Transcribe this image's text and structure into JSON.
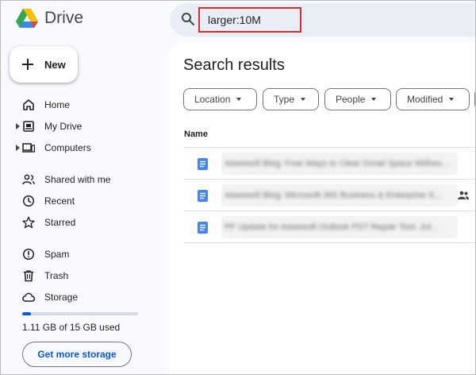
{
  "app": {
    "name": "Drive"
  },
  "search": {
    "query": "larger:10M"
  },
  "sidebar": {
    "new_label": "New",
    "items": [
      {
        "label": "Home",
        "icon": "home-icon"
      },
      {
        "label": "My Drive",
        "icon": "drive-icon"
      },
      {
        "label": "Computers",
        "icon": "computer-icon"
      },
      {
        "label": "Shared with me",
        "icon": "people-icon"
      },
      {
        "label": "Recent",
        "icon": "clock-icon"
      },
      {
        "label": "Starred",
        "icon": "star-icon"
      },
      {
        "label": "Spam",
        "icon": "spam-icon"
      },
      {
        "label": "Trash",
        "icon": "trash-icon"
      },
      {
        "label": "Storage",
        "icon": "cloud-icon"
      }
    ],
    "storage": {
      "used_text": "1.11 GB of 15 GB used",
      "used_fraction": 0.074,
      "button_label": "Get more storage"
    }
  },
  "main": {
    "title": "Search results",
    "filters": [
      "Location",
      "Type",
      "People",
      "Modified"
    ],
    "column_name": "Name",
    "rows": [
      {
        "name": "Aiseesoft Blog: Free Ways to Clear Gmail Space Without ...",
        "shared": false
      },
      {
        "name": "Aiseesoft Blog: Microsoft 365 Business & Enterprise S...",
        "shared": true
      },
      {
        "name": "PF Update for Aiseesoft Outlook PST Repair Tool: Jul...",
        "shared": false
      }
    ]
  },
  "colors": {
    "accent": "#0b57d0",
    "highlight_box": "#d32f2f",
    "doc_icon": "#4285f4"
  }
}
